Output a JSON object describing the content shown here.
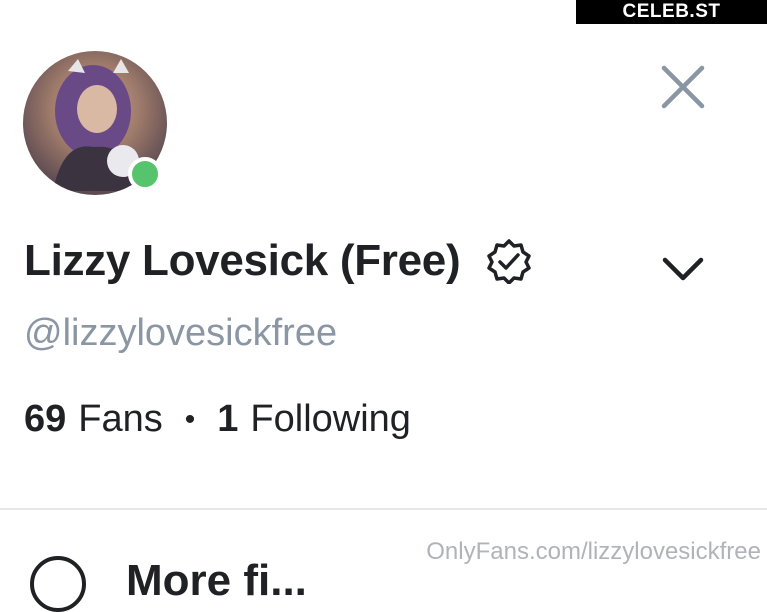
{
  "watermark_top": "CELEB.ST",
  "profile": {
    "display_name": "Lizzy Lovesick (Free)",
    "handle": "@lizzylovesickfree",
    "fans_count": "69",
    "fans_label": "Fans",
    "separator": "•",
    "following_count": "1",
    "following_label": "Following",
    "online": true
  },
  "more_section": {
    "label": "More fi..."
  },
  "watermark_bottom": "OnlyFans.com/lizzylovesickfree",
  "colors": {
    "online_green": "#55c46c",
    "handle_gray": "#8a96a3",
    "icon_gray": "#8a96a3",
    "text_dark": "#1f2125"
  },
  "icons": {
    "close": "close-icon",
    "verified": "verified-badge-icon",
    "chevron": "chevron-down-icon",
    "more": "more-icon"
  }
}
